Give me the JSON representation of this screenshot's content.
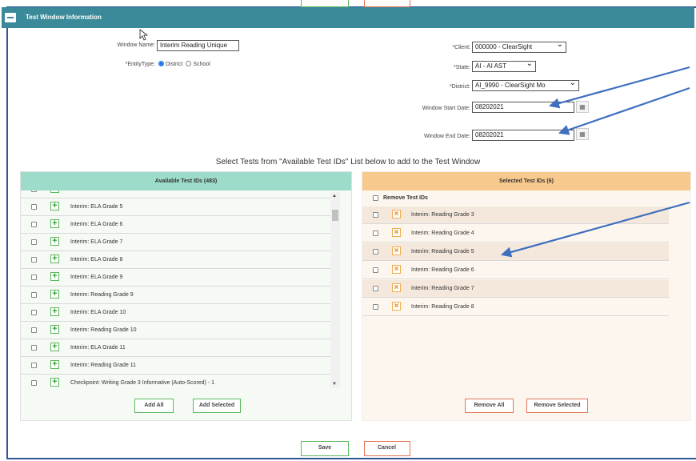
{
  "header": {
    "title": "Test Window Information"
  },
  "form": {
    "window_name_label": "Window Name:",
    "window_name_value": "Interim Reading Unique",
    "entity_type_label": "*EntityType:",
    "entity_type_options": [
      "District",
      "School"
    ],
    "client_label": "*Client:",
    "client_value": "000000 - ClearSight",
    "state_label": "*State:",
    "state_value": "AI - AI AST",
    "district_label": "*District:",
    "district_value": "AI_9990 - ClearSight Mo",
    "start_date_label": "Window Start Date:",
    "start_date_value": "08202021",
    "end_date_label": "Window End Date:",
    "end_date_value": "08202021"
  },
  "instructions": "Select Tests from \"Available Test IDs\" List below to add to the Test Window",
  "available": {
    "title": "Available Test IDs (483)",
    "items": [
      "Interim: ELA Grade 5",
      "Interim: ELA Grade 6",
      "Interim: ELA Grade 7",
      "Interim: ELA Grade 8",
      "Interim: ELA Grade 9",
      "Interim: Reading Grade 9",
      "Interim: ELA Grade 10",
      "Interim: Reading Grade 10",
      "Interim: ELA Grade 11",
      "Interim: Reading Grade 11",
      "Checkpoint: Writing Grade 3 Informative (Auto-Scored) - 1"
    ],
    "add_all_label": "Add All",
    "add_selected_label": "Add Selected"
  },
  "selected": {
    "title": "Selected Test IDs (6)",
    "remove_header": "Remove Test IDs",
    "items": [
      "Interim: Reading Grade 3",
      "Interim: Reading Grade 4",
      "Interim: Reading Grade 5",
      "Interim: Reading Grade 6",
      "Interim: Reading Grade 7",
      "Interim: Reading Grade 8"
    ],
    "remove_all_label": "Remove All",
    "remove_selected_label": "Remove Selected"
  },
  "footer": {
    "save_label": "Save",
    "cancel_label": "Cancel"
  },
  "colors": {
    "header": "#3a8a99",
    "available_header": "#9ddbcb",
    "selected_header": "#f8c98d",
    "frame_border": "#2f5597",
    "annotation_arrow": "#3f6fbf"
  },
  "icons": [
    "collapse-icon",
    "cursor-icon",
    "calendar-icon",
    "plus-icon",
    "remove-x-icon",
    "annotation-arrow"
  ]
}
